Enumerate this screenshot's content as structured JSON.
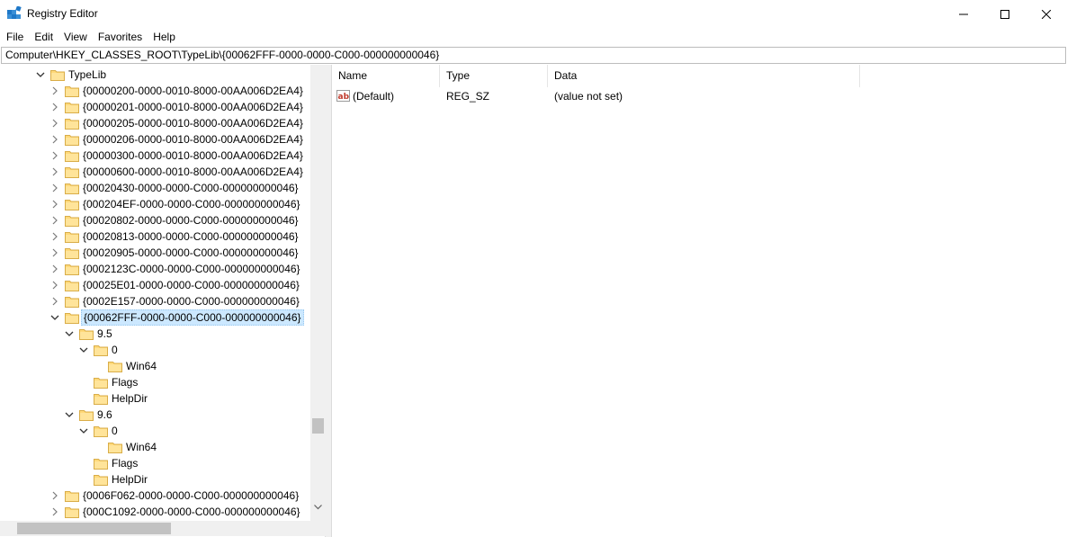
{
  "window": {
    "title": "Registry Editor"
  },
  "menu": [
    "File",
    "Edit",
    "View",
    "Favorites",
    "Help"
  ],
  "address": "Computer\\HKEY_CLASSES_ROOT\\TypeLib\\{00062FFF-0000-0000-C000-000000000046}",
  "tree": {
    "root_label": "TypeLib",
    "items": [
      "{00000200-0000-0010-8000-00AA006D2EA4}",
      "{00000201-0000-0010-8000-00AA006D2EA4}",
      "{00000205-0000-0010-8000-00AA006D2EA4}",
      "{00000206-0000-0010-8000-00AA006D2EA4}",
      "{00000300-0000-0010-8000-00AA006D2EA4}",
      "{00000600-0000-0010-8000-00AA006D2EA4}",
      "{00020430-0000-0000-C000-000000000046}",
      "{000204EF-0000-0000-C000-000000000046}",
      "{00020802-0000-0000-C000-000000000046}",
      "{00020813-0000-0000-C000-000000000046}",
      "{00020905-0000-0000-C000-000000000046}",
      "{0002123C-0000-0000-C000-000000000046}",
      "{00025E01-0000-0000-C000-000000000046}",
      "{0002E157-0000-0000-C000-000000000046}"
    ],
    "selected": "{00062FFF-0000-0000-C000-000000000046}",
    "v95": {
      "label": "9.5",
      "sub0": "0",
      "win64": "Win64",
      "flags": "Flags",
      "helpdir": "HelpDir"
    },
    "v96": {
      "label": "9.6",
      "sub0": "0",
      "win64": "Win64",
      "flags": "Flags",
      "helpdir": "HelpDir"
    },
    "after": [
      "{0006F062-0000-0000-C000-000000000046}",
      "{000C1092-0000-0000-C000-000000000046}"
    ]
  },
  "list": {
    "columns": [
      "Name",
      "Type",
      "Data"
    ],
    "rows": [
      {
        "icon": "string-value-icon",
        "name": "(Default)",
        "type": "REG_SZ",
        "data": "(value not set)"
      }
    ]
  },
  "colors": {
    "selection": "#cce8ff",
    "folder": "#ffd97a",
    "accent": "#0078d7"
  }
}
